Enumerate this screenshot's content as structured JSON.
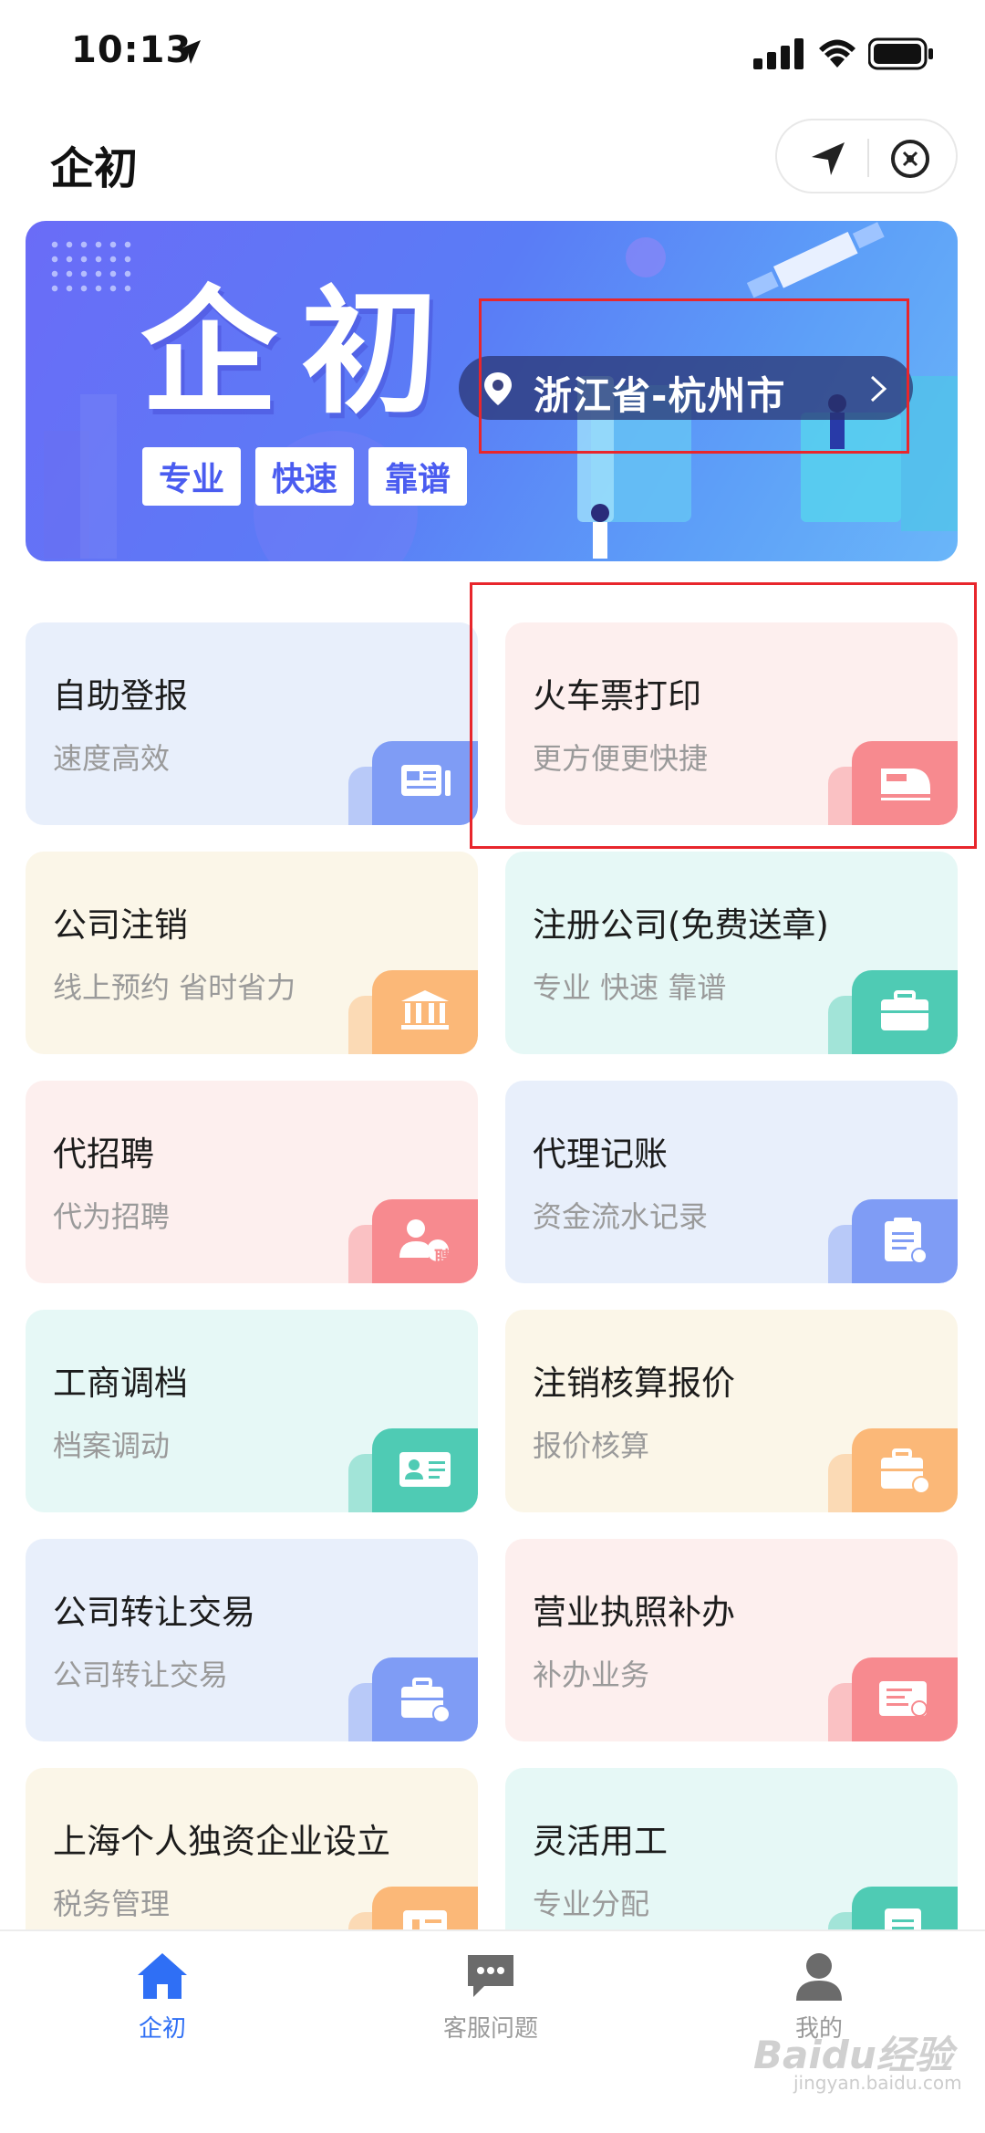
{
  "status_bar": {
    "time": "10:13"
  },
  "header": {
    "title": "企初"
  },
  "banner": {
    "title": "企初",
    "tags": [
      "专业",
      "快速",
      "靠谱"
    ],
    "location": "浙江省-杭州市"
  },
  "services": [
    {
      "title": "自助登报",
      "subtitle": "速度高效",
      "icon": "newspaper-icon",
      "accent": "#7f9cf5"
    },
    {
      "title": "火车票打印",
      "subtitle": "更方便更快捷",
      "icon": "train-icon",
      "accent": "#f78a8f"
    },
    {
      "title": "公司注销",
      "subtitle": "线上预约 省时省力",
      "icon": "bank-icon",
      "accent": "#fbb878"
    },
    {
      "title": "注册公司(免费送章)",
      "subtitle": "专业 快速 靠谱",
      "icon": "briefcase-icon",
      "accent": "#4fcbb4"
    },
    {
      "title": "代招聘",
      "subtitle": "代为招聘",
      "icon": "recruit-icon",
      "accent": "#f78a8f",
      "badge": "聘"
    },
    {
      "title": "代理记账",
      "subtitle": "资金流水记录",
      "icon": "clipboard-icon",
      "accent": "#7f9cf5"
    },
    {
      "title": "工商调档",
      "subtitle": "档案调动",
      "icon": "id-card-icon",
      "accent": "#4fcbb4"
    },
    {
      "title": "注销核算报价",
      "subtitle": "报价核算",
      "icon": "toolbox-icon",
      "accent": "#fbb878"
    },
    {
      "title": "公司转让交易",
      "subtitle": "公司转让交易",
      "icon": "transfer-briefcase-icon",
      "accent": "#7f9cf5"
    },
    {
      "title": "营业执照补办",
      "subtitle": "补办业务",
      "icon": "license-icon",
      "accent": "#f78a8f"
    },
    {
      "title": "上海个人独资企业设立",
      "subtitle": "税务管理",
      "icon": "building-icon",
      "accent": "#fbb878"
    },
    {
      "title": "灵活用工",
      "subtitle": "专业分配",
      "icon": "document-icon",
      "accent": "#4fcbb4"
    }
  ],
  "tabbar": {
    "home": "企初",
    "service": "客服问题",
    "mine": "我的"
  },
  "watermark": {
    "brand": "Baidu经验",
    "url": "jingyan.baidu.com"
  },
  "colors": {
    "active_tab": "#2f6ff5",
    "annotation": "#e8262c"
  }
}
